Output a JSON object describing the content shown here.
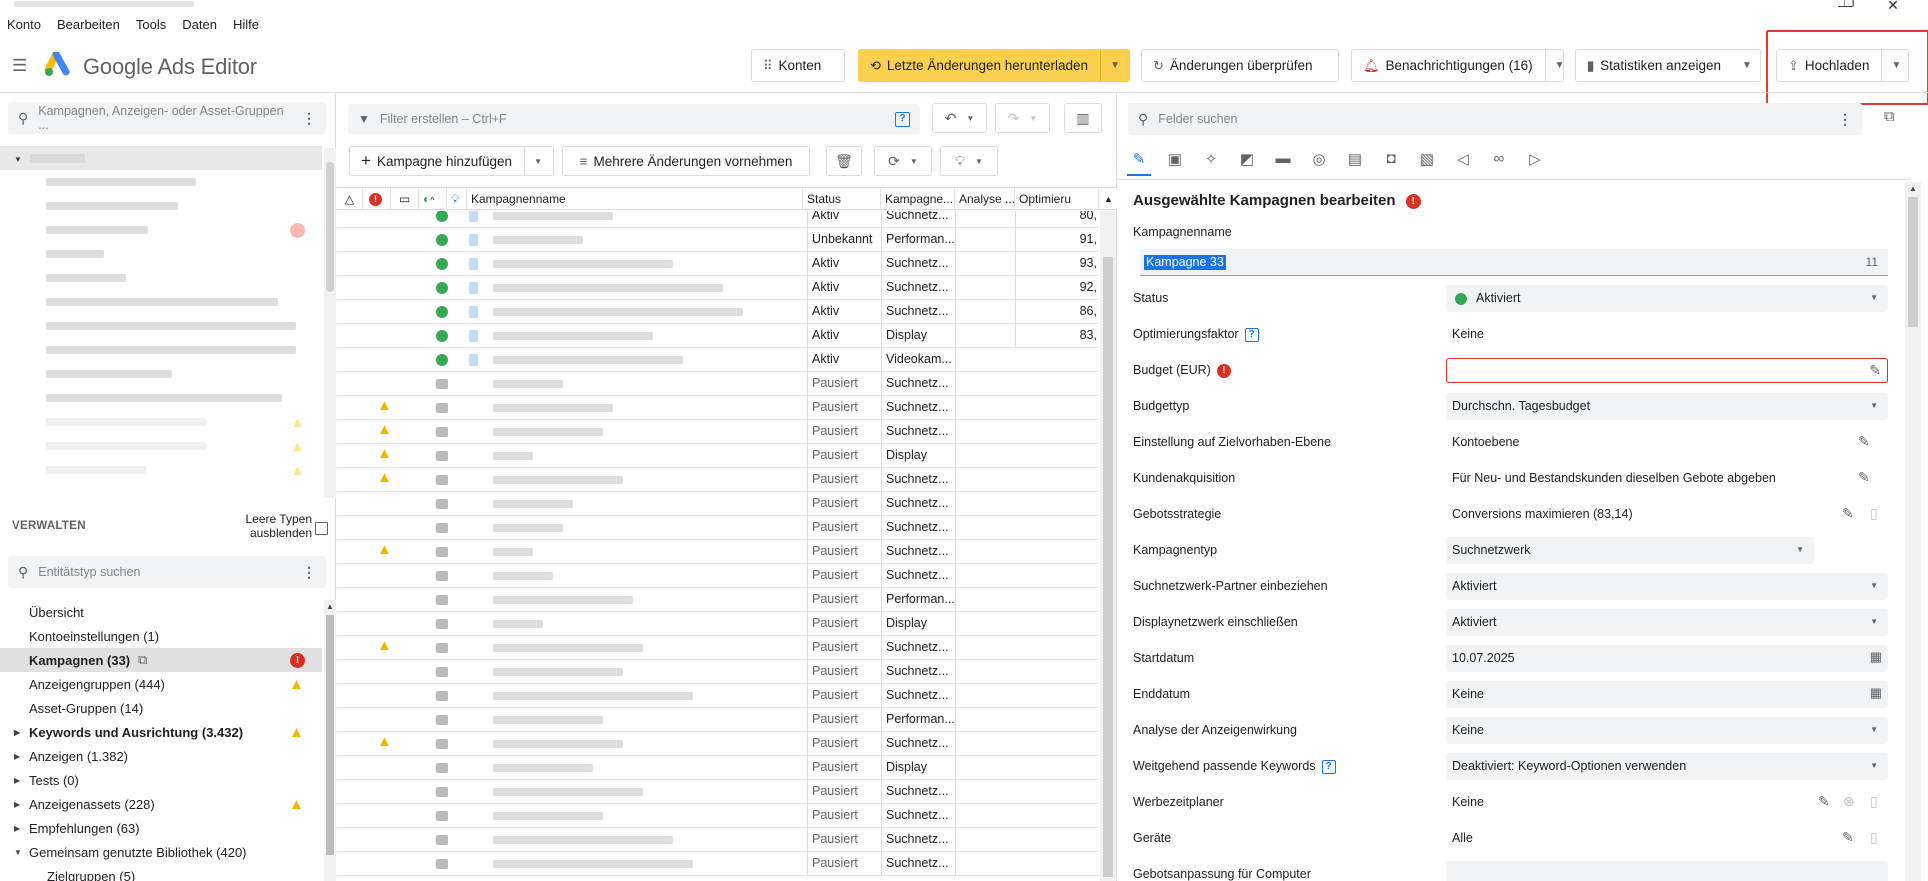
{
  "window": {
    "min": "—",
    "restore": "❐",
    "close": "✕"
  },
  "menu": [
    "Konto",
    "Bearbeiten",
    "Tools",
    "Daten",
    "Hilfe"
  ],
  "app": {
    "name": "Google Ads Editor"
  },
  "toolbar": {
    "konten": "Konten",
    "download": "Letzte Änderungen herunterladen",
    "review": "Änderungen überprüfen",
    "notifications": "Benachrichtigungen (16)",
    "stats": "Statistiken anzeigen",
    "upload": "Hochladen"
  },
  "left": {
    "search_placeholder": "Kampagnen, Anzeigen- oder Asset-Gruppen ...",
    "manage_title": "VERWALTEN",
    "empty_types": "Leere Typen ausblenden",
    "entity_search_placeholder": "Entitätstyp suchen",
    "items": [
      {
        "label": "Übersicht",
        "state": ""
      },
      {
        "label": "Kontoeinstellungen (1)",
        "state": ""
      },
      {
        "label": "Kampagnen (33)",
        "state": "error"
      },
      {
        "label": "Anzeigengruppen (444)",
        "state": "warn"
      },
      {
        "label": "Asset-Gruppen (14)",
        "state": ""
      },
      {
        "label": "Keywords und Ausrichtung (3.432)",
        "state": "warn"
      },
      {
        "label": "Anzeigen (1.382)",
        "state": ""
      },
      {
        "label": "Tests (0)",
        "state": ""
      },
      {
        "label": "Anzeigenassets (228)",
        "state": "warn"
      },
      {
        "label": "Empfehlungen (63)",
        "state": ""
      },
      {
        "label": "Gemeinsam genutzte Bibliothek (420)",
        "state": ""
      },
      {
        "label": "Zielgruppen (5)",
        "state": ""
      }
    ]
  },
  "middle": {
    "filter_placeholder": "Filter erstellen – Ctrl+F",
    "add_campaign": "Kampagne hinzufügen",
    "multi_changes": "Mehrere Änderungen vornehmen",
    "columns": [
      "Kampagnenname",
      "Status",
      "Kampagne...",
      "Analyse ...",
      "Optimieru"
    ],
    "rows": [
      {
        "status": "Aktiv",
        "type": "Suchnetz...",
        "opt": "80,",
        "dot": "g",
        "warn": false
      },
      {
        "status": "Unbekannt",
        "type": "Performan...",
        "opt": "91,",
        "dot": "g",
        "warn": false
      },
      {
        "status": "Aktiv",
        "type": "Suchnetz...",
        "opt": "93,",
        "dot": "g",
        "warn": false
      },
      {
        "status": "Aktiv",
        "type": "Suchnetz...",
        "opt": "92,",
        "dot": "g",
        "warn": false
      },
      {
        "status": "Aktiv",
        "type": "Suchnetz...",
        "opt": "86,",
        "dot": "g",
        "warn": false
      },
      {
        "status": "Aktiv",
        "type": "Display",
        "opt": "83,",
        "dot": "g",
        "warn": false
      },
      {
        "status": "Aktiv",
        "type": "Videokam...",
        "opt": "",
        "dot": "g",
        "warn": false
      },
      {
        "status": "Pausiert",
        "type": "Suchnetz...",
        "opt": "",
        "dot": "x",
        "warn": false
      },
      {
        "status": "Pausiert",
        "type": "Suchnetz...",
        "opt": "",
        "dot": "x",
        "warn": true
      },
      {
        "status": "Pausiert",
        "type": "Suchnetz...",
        "opt": "",
        "dot": "x",
        "warn": true
      },
      {
        "status": "Pausiert",
        "type": "Display",
        "opt": "",
        "dot": "x",
        "warn": true
      },
      {
        "status": "Pausiert",
        "type": "Suchnetz...",
        "opt": "",
        "dot": "x",
        "warn": true
      },
      {
        "status": "Pausiert",
        "type": "Suchnetz...",
        "opt": "",
        "dot": "x",
        "warn": false
      },
      {
        "status": "Pausiert",
        "type": "Suchnetz...",
        "opt": "",
        "dot": "x",
        "warn": false
      },
      {
        "status": "Pausiert",
        "type": "Suchnetz...",
        "opt": "",
        "dot": "x",
        "warn": true
      },
      {
        "status": "Pausiert",
        "type": "Suchnetz...",
        "opt": "",
        "dot": "x",
        "warn": false
      },
      {
        "status": "Pausiert",
        "type": "Performan...",
        "opt": "",
        "dot": "x",
        "warn": false
      },
      {
        "status": "Pausiert",
        "type": "Display",
        "opt": "",
        "dot": "x",
        "warn": false
      },
      {
        "status": "Pausiert",
        "type": "Suchnetz...",
        "opt": "",
        "dot": "x",
        "warn": true
      },
      {
        "status": "Pausiert",
        "type": "Suchnetz...",
        "opt": "",
        "dot": "x",
        "warn": false
      },
      {
        "status": "Pausiert",
        "type": "Suchnetz...",
        "opt": "",
        "dot": "x",
        "warn": false
      },
      {
        "status": "Pausiert",
        "type": "Performan...",
        "opt": "",
        "dot": "x",
        "warn": false
      },
      {
        "status": "Pausiert",
        "type": "Suchnetz...",
        "opt": "",
        "dot": "x",
        "warn": true
      },
      {
        "status": "Pausiert",
        "type": "Display",
        "opt": "",
        "dot": "x",
        "warn": false
      },
      {
        "status": "Pausiert",
        "type": "Suchnetz...",
        "opt": "",
        "dot": "x",
        "warn": false
      },
      {
        "status": "Pausiert",
        "type": "Suchnetz...",
        "opt": "",
        "dot": "x",
        "warn": false
      },
      {
        "status": "Pausiert",
        "type": "Suchnetz...",
        "opt": "",
        "dot": "x",
        "warn": false
      },
      {
        "status": "Pausiert",
        "type": "Suchnetz...",
        "opt": "",
        "dot": "x",
        "warn": false
      }
    ]
  },
  "right": {
    "search_placeholder": "Felder suchen",
    "title": "Ausgewählte Kampagnen bearbeiten",
    "name_label": "Kampagnenname",
    "name_value": "Kampagne 33",
    "name_len": "11",
    "fields": [
      {
        "label": "Status",
        "value": "Aktiviert",
        "kind": "select-dot"
      },
      {
        "label": "Optimierungsfaktor",
        "value": "Keine",
        "kind": "text-help"
      },
      {
        "label": "Budget (EUR)",
        "value": "",
        "kind": "error-input"
      },
      {
        "label": "Budgettyp",
        "value": "Durchschn. Tagesbudget",
        "kind": "select"
      },
      {
        "label": "Einstellung auf Zielvorhaben-Ebene",
        "value": "Kontoebene",
        "kind": "edit"
      },
      {
        "label": "Kundenakquisition",
        "value": "Für Neu- und Bestandskunden dieselben Gebote abgeben",
        "kind": "edit"
      },
      {
        "label": "Gebotsstrategie",
        "value": "Conversions maximieren (83,14)",
        "kind": "edit2"
      },
      {
        "label": "Kampagnentyp",
        "value": "Suchnetzwerk",
        "kind": "select-short"
      },
      {
        "label": "Suchnetzwerk-Partner einbeziehen",
        "value": "Aktiviert",
        "kind": "select"
      },
      {
        "label": "Displaynetzwerk einschließen",
        "value": "Aktiviert",
        "kind": "select"
      },
      {
        "label": "Startdatum",
        "value": "10.07.2025",
        "kind": "date"
      },
      {
        "label": "Enddatum",
        "value": "Keine",
        "kind": "date"
      },
      {
        "label": "Analyse der Anzeigenwirkung",
        "value": "Keine",
        "kind": "select"
      },
      {
        "label": "Weitgehend passende Keywords",
        "value": "Deaktiviert: Keyword-Optionen verwenden",
        "kind": "select-help"
      },
      {
        "label": "Werbezeitplaner",
        "value": "Keine",
        "kind": "edit3"
      },
      {
        "label": "Geräte",
        "value": "Alle",
        "kind": "edit2"
      },
      {
        "label": "Gebotsanpassung für Computer",
        "value": "",
        "kind": "cut"
      }
    ]
  }
}
